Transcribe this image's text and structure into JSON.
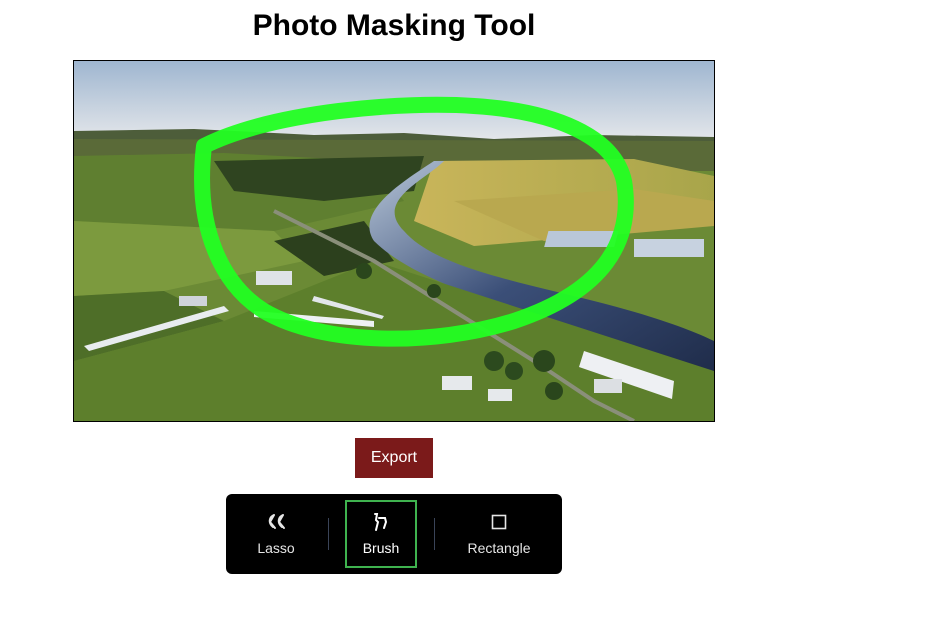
{
  "app": {
    "title": "Photo Masking Tool"
  },
  "canvas": {
    "image_description_icon": "landscape-photo",
    "mask_color": "#22ff22"
  },
  "actions": {
    "export_label": "Export",
    "export_color": "#7b1a1a"
  },
  "toolbar": {
    "active_tool": "Brush",
    "active_border_color": "#3fb34f",
    "tools": [
      {
        "label": "Lasso",
        "icon": "lasso-icon"
      },
      {
        "label": "Brush",
        "icon": "brush-icon"
      },
      {
        "label": "Rectangle",
        "icon": "rectangle-icon"
      }
    ]
  }
}
